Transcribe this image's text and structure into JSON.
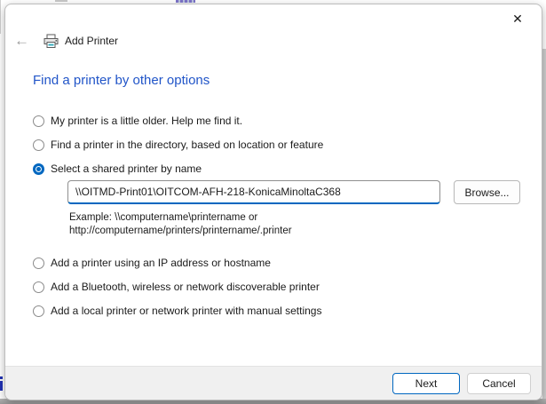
{
  "window": {
    "title": "Add Printer"
  },
  "icons": {
    "back": "←",
    "close": "✕",
    "printer": "printer-glyph"
  },
  "heading": "Find a printer by other options",
  "options": [
    {
      "label": "My printer is a little older. Help me find it.",
      "selected": false
    },
    {
      "label": "Find a printer in the directory, based on location or feature",
      "selected": false
    },
    {
      "label": "Select a shared printer by name",
      "selected": true
    },
    {
      "label": "Add a printer using an IP address or hostname",
      "selected": false
    },
    {
      "label": "Add a Bluetooth, wireless or network discoverable printer",
      "selected": false
    },
    {
      "label": "Add a local printer or network printer with manual settings",
      "selected": false
    }
  ],
  "shared_printer": {
    "value": "\\\\OITMD-Print01\\OITCOM-AFH-218-KonicaMinoltaC368",
    "browse_label": "Browse...",
    "example_line1": "Example: \\\\computername\\printername or",
    "example_line2": "http://computername/printers/printername/.printer"
  },
  "footer": {
    "next_label": "Next",
    "cancel_label": "Cancel"
  },
  "colors": {
    "accent": "#0067c0",
    "heading": "#2155c8"
  }
}
